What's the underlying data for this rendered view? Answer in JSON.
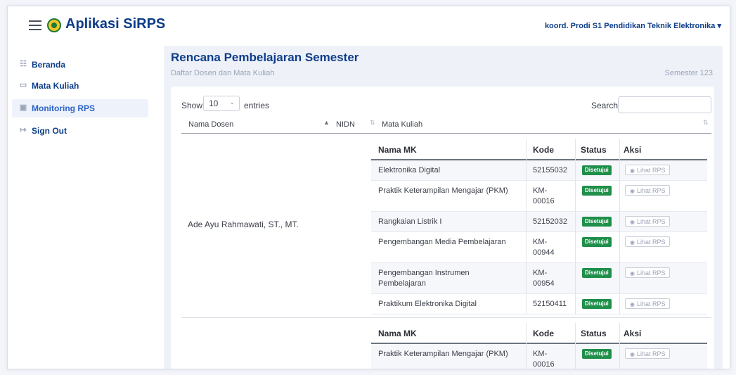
{
  "app": {
    "title": "Aplikasi SiRPS",
    "user_menu": "koord. Prodi S1 Pendidikan Teknik Elektronika ▾"
  },
  "sidebar": {
    "items": [
      {
        "label": "Beranda",
        "icon": "☷"
      },
      {
        "label": "Mata Kuliah",
        "icon": "▭"
      },
      {
        "label": "Monitoring RPS",
        "icon": "▣"
      },
      {
        "label": "Sign Out",
        "icon": "↦"
      }
    ]
  },
  "page": {
    "title": "Rencana Pembelajaran Semester",
    "subtitle": "Daftar Dosen dan Mata Kuliah",
    "semester": "Semester 123"
  },
  "table_controls": {
    "show": "Show",
    "length_value": "10",
    "entries": "entries",
    "search_label": "Search:"
  },
  "columns": {
    "nama_dosen": "Nama Dosen",
    "nidn": "NIDN",
    "mata_kuliah": "Mata Kuliah"
  },
  "inner_headers": {
    "nama_mk": "Nama MK",
    "kode": "Kode",
    "status": "Status",
    "aksi": "Aksi"
  },
  "action_label": "Lihat RPS",
  "status_label": "Disetujui",
  "colors": {
    "brand": "#0d3d8a",
    "status_approved": "#1f8f4a",
    "active_nav": "#2c64c6"
  },
  "groups": [
    {
      "dosen": "Ade Ayu Rahmawati, ST., MT.",
      "nidn": "",
      "courses": [
        {
          "mk": "Elektronika Digital",
          "kode": "52155032",
          "status": "Disetujui"
        },
        {
          "mk": "Praktik Keterampilan Mengajar (PKM)",
          "kode": "KM-00016",
          "status": "Disetujui"
        },
        {
          "mk": "Rangkaian Listrik I",
          "kode": "52152032",
          "status": "Disetujui"
        },
        {
          "mk": "Pengembangan Media Pembelajaran",
          "kode": "KM-00944",
          "status": "Disetujui"
        },
        {
          "mk": "Pengembangan Instrumen Pembelajaran",
          "kode": "KM-00954",
          "status": "Disetujui"
        },
        {
          "mk": "Praktikum Elektronika Digital",
          "kode": "52150411",
          "status": "Disetujui"
        }
      ]
    },
    {
      "dosen": "",
      "nidn": "",
      "courses": [
        {
          "mk": "Praktik Keterampilan Mengajar (PKM)",
          "kode": "KM-00016",
          "status": "Disetujui"
        }
      ]
    }
  ]
}
